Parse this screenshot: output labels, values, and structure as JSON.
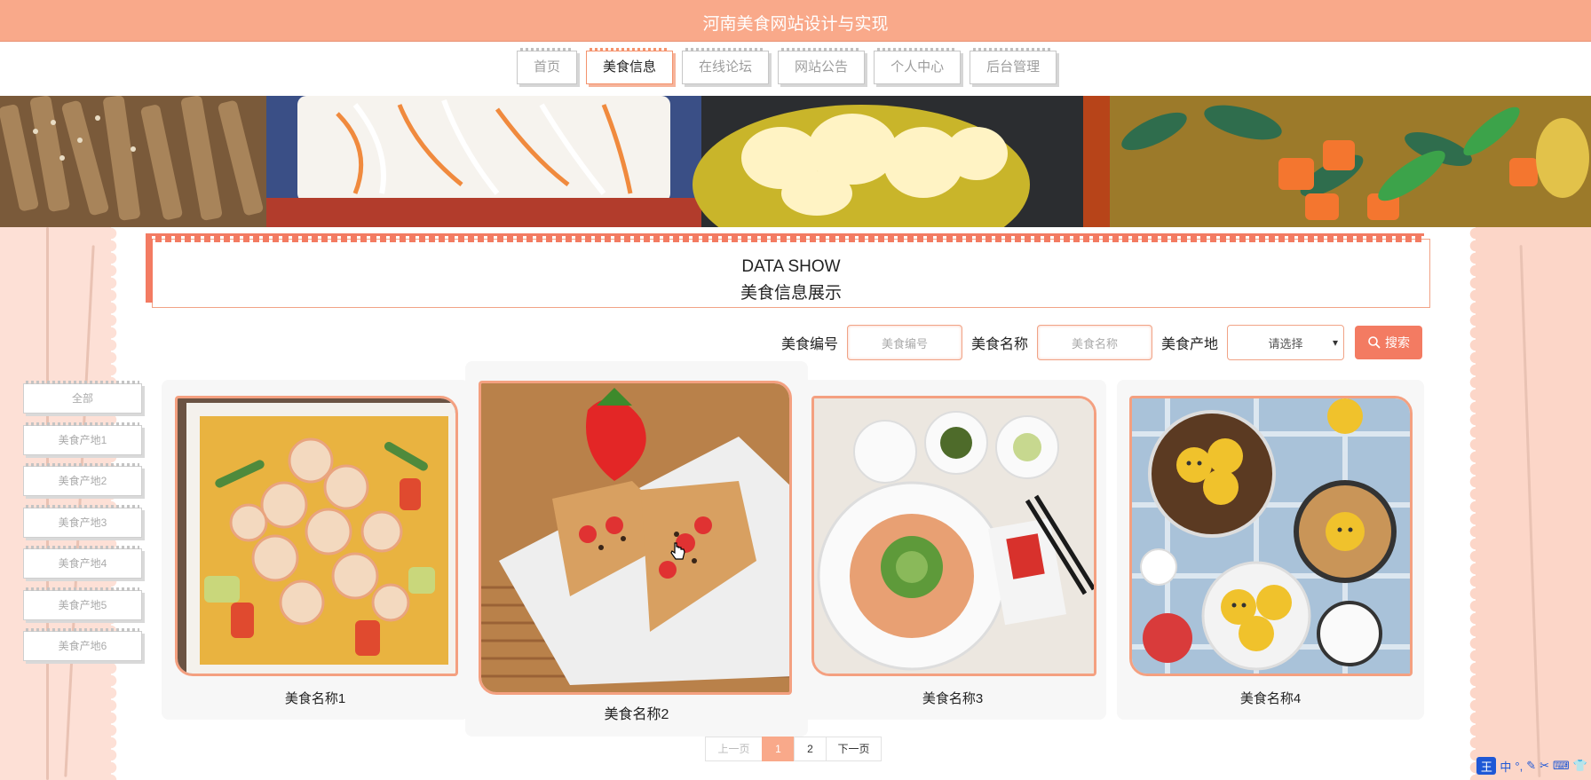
{
  "site": {
    "title": "河南美食网站设计与实现"
  },
  "nav": {
    "items": [
      {
        "label": "首页",
        "active": false
      },
      {
        "label": "美食信息",
        "active": true
      },
      {
        "label": "在线论坛",
        "active": false
      },
      {
        "label": "网站公告",
        "active": false
      },
      {
        "label": "个人中心",
        "active": false
      },
      {
        "label": "后台管理",
        "active": false
      }
    ]
  },
  "section": {
    "title_en": "DATA SHOW",
    "title_cn": "美食信息展示"
  },
  "search": {
    "field1_label": "美食编号",
    "field1_placeholder": "美食编号",
    "field2_label": "美食名称",
    "field2_placeholder": "美食名称",
    "field3_label": "美食产地",
    "field3_value": "请选择",
    "button_label": "搜索"
  },
  "categories": [
    "全部",
    "美食产地1",
    "美食产地2",
    "美食产地3",
    "美食产地4",
    "美食产地5",
    "美食产地6"
  ],
  "foods": [
    {
      "name": "美食名称1"
    },
    {
      "name": "美食名称2"
    },
    {
      "name": "美食名称3"
    },
    {
      "name": "美食名称4"
    }
  ],
  "pagination": {
    "prev": "上一页",
    "pages": [
      "1",
      "2"
    ],
    "current": "1",
    "next": "下一页"
  },
  "ime": {
    "logo": "王",
    "mode": "中"
  },
  "colors": {
    "accent": "#f9a98a",
    "accent_dark": "#f37b62",
    "border": "#f1a386"
  }
}
